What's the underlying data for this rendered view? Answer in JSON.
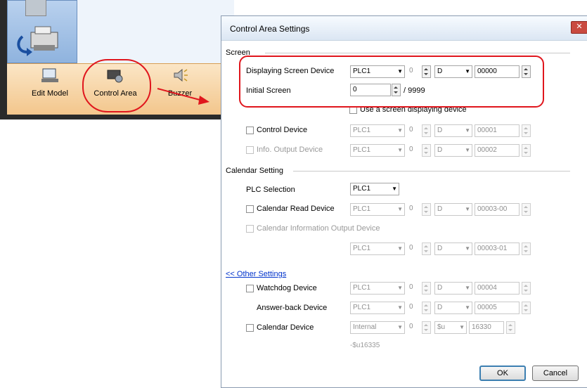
{
  "toolbar": {
    "buttons": [
      {
        "label": "Edit Model",
        "icon": "edit-model-icon"
      },
      {
        "label": "Control Area",
        "icon": "control-area-icon"
      },
      {
        "label": "Buzzer",
        "icon": "buzzer-icon"
      }
    ]
  },
  "dialog": {
    "title": "Control Area Settings",
    "close_glyph": "✕",
    "screen_section": "Screen",
    "displaying_screen_device_label": "Displaying Screen Device",
    "displaying_screen_device": {
      "plc": "PLC1",
      "port": "0",
      "device": "D",
      "address": "00000"
    },
    "initial_screen_label": "Initial Screen",
    "initial_screen_value": "0",
    "initial_screen_max": "/ 9999",
    "use_screen_displaying_device_label": "Use a screen displaying device",
    "control_device_label": "Control Device",
    "control_device": {
      "plc": "PLC1",
      "port": "0",
      "device": "D",
      "address": "00001"
    },
    "info_output_device_label": "Info. Output Device",
    "info_output_device": {
      "plc": "PLC1",
      "port": "0",
      "device": "D",
      "address": "00002"
    },
    "calendar_section": "Calendar Setting",
    "plc_selection_label": "PLC Selection",
    "plc_selection_value": "PLC1",
    "calendar_read_device_label": "Calendar Read Device",
    "calendar_read_device": {
      "plc": "PLC1",
      "port": "0",
      "device": "D",
      "address": "00003-00"
    },
    "calendar_info_output_label": "Calendar Information Output Device",
    "calendar_info_output": {
      "plc": "PLC1",
      "port": "0",
      "device": "D",
      "address": "00003-01"
    },
    "other_settings_link": "<< Other Settings",
    "watchdog_device_label": "Watchdog Device",
    "watchdog_device": {
      "plc": "PLC1",
      "port": "0",
      "device": "D",
      "address": "00004"
    },
    "answer_back_device_label": "Answer-back Device",
    "answer_back_device": {
      "plc": "PLC1",
      "port": "0",
      "device": "D",
      "address": "00005"
    },
    "calendar_device_label": "Calendar Device",
    "calendar_device": {
      "plc": "Internal",
      "port": "0",
      "device": "$u",
      "address": "16330"
    },
    "calendar_device_note": "-$u16335",
    "ok_label": "OK",
    "cancel_label": "Cancel"
  },
  "colors": {
    "highlight": "#e0161d",
    "tab_bar": "#f3c68c",
    "link": "#0033cc"
  }
}
